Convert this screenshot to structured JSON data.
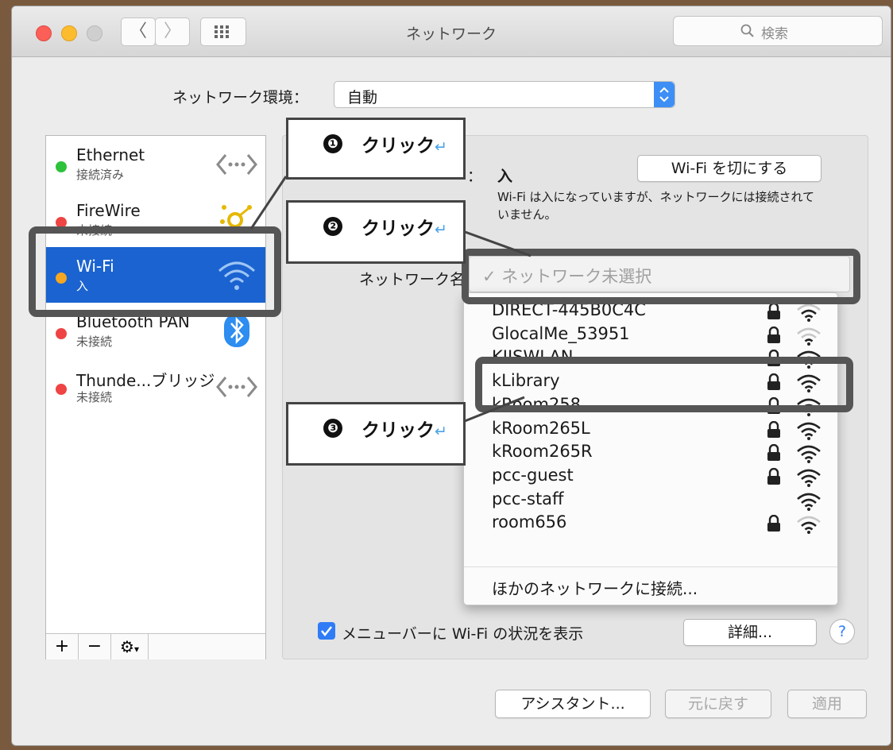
{
  "window": {
    "title": "ネットワーク"
  },
  "toolbar": {
    "back_label": "〈",
    "forward_label": "〉",
    "search_placeholder": "検索"
  },
  "location": {
    "label": "ネットワーク環境：",
    "value": "自動"
  },
  "services": [
    {
      "name": "Ethernet",
      "status": "接続済み",
      "dot_color": "#2ec13c",
      "icon": "ethernet-arrows-icon"
    },
    {
      "name": "FireWire",
      "status": "未接続",
      "dot_color": "#ee4444",
      "icon": "firewire-icon"
    },
    {
      "name": "Wi-Fi",
      "status": "入",
      "dot_color": "#f5a623",
      "icon": "wifi-icon"
    },
    {
      "name": "Bluetooth PAN",
      "status": "未接続",
      "dot_color": "#ee4444",
      "icon": "bluetooth-icon"
    },
    {
      "name": "Thunde...ブリッジ",
      "status": "未接続",
      "dot_color": "#ee4444",
      "icon": "ethernet-arrows-icon"
    }
  ],
  "sidebar_footer": {
    "add": "+",
    "remove": "−",
    "gear": "⚙"
  },
  "status": {
    "label_suffix": "：",
    "value": "入",
    "description": "Wi-Fi は入になっていますが、ネットワークには接続されていません。",
    "turn_off_button": "Wi-Fi を切にする"
  },
  "network_name": {
    "label": "ネットワーク名",
    "selected": "✓ ネットワーク未選択"
  },
  "networks": [
    {
      "name": "DIRECT-445B0C4C",
      "locked": true,
      "signal": 2
    },
    {
      "name": "GlocalMe_53951",
      "locked": true,
      "signal": 1
    },
    {
      "name": "KIISWLAN",
      "locked": true,
      "signal": 3
    },
    {
      "name": "kLibrary",
      "locked": true,
      "signal": 3
    },
    {
      "name": "kRoom258",
      "locked": true,
      "signal": 3
    },
    {
      "name": "kRoom265L",
      "locked": true,
      "signal": 3
    },
    {
      "name": "kRoom265R",
      "locked": true,
      "signal": 3
    },
    {
      "name": "pcc-guest",
      "locked": true,
      "signal": 3
    },
    {
      "name": "pcc-staff",
      "locked": false,
      "signal": 3
    },
    {
      "name": "room656",
      "locked": true,
      "signal": 2
    }
  ],
  "other_network": "ほかのネットワークに接続...",
  "show_in_menubar": {
    "label": "メニューバーに Wi-Fi の状況を表示",
    "checked": true
  },
  "advanced_button": "詳細...",
  "help_button": "?",
  "bottom_buttons": {
    "assistant": "アシスタント...",
    "revert": "元に戻す",
    "apply": "適用"
  },
  "callouts": [
    {
      "num": "❶",
      "text": "クリック",
      "ret": "↵"
    },
    {
      "num": "❷",
      "text": "クリック",
      "ret": "↵"
    },
    {
      "num": "❸",
      "text": "クリック",
      "ret": "↵"
    }
  ]
}
